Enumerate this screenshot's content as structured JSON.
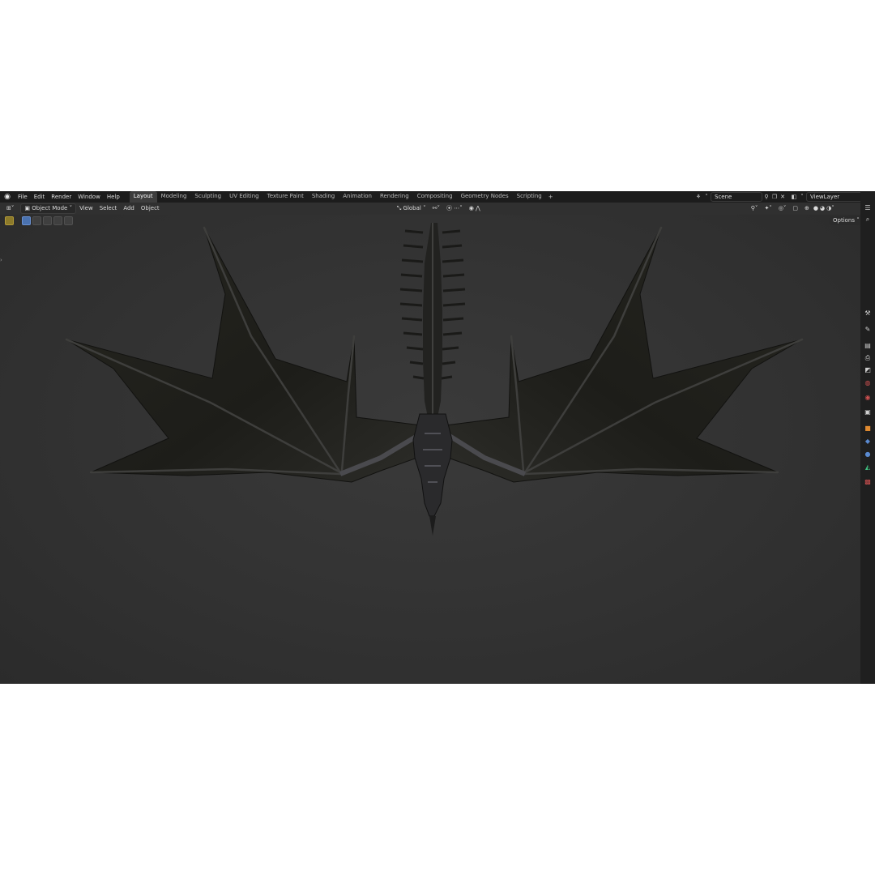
{
  "menu": [
    "File",
    "Edit",
    "Render",
    "Window",
    "Help"
  ],
  "workspaces": [
    {
      "label": "Layout",
      "active": true
    },
    {
      "label": "Modeling"
    },
    {
      "label": "Sculpting"
    },
    {
      "label": "UV Editing"
    },
    {
      "label": "Texture Paint"
    },
    {
      "label": "Shading"
    },
    {
      "label": "Animation"
    },
    {
      "label": "Rendering"
    },
    {
      "label": "Compositing"
    },
    {
      "label": "Geometry Nodes"
    },
    {
      "label": "Scripting"
    }
  ],
  "add_workspace": "+",
  "scene": {
    "name": "Scene"
  },
  "view_layer": {
    "name": "ViewLayer"
  },
  "header": {
    "mode": "Object Mode",
    "view": "View",
    "select": "Select",
    "add": "Add",
    "object": "Object",
    "orientation": "Global"
  },
  "options": "Options",
  "colors": {
    "accent": "#4a72b0",
    "viewport_bg": "#323232",
    "topbar": "#1c1c1c",
    "header": "#303030"
  }
}
